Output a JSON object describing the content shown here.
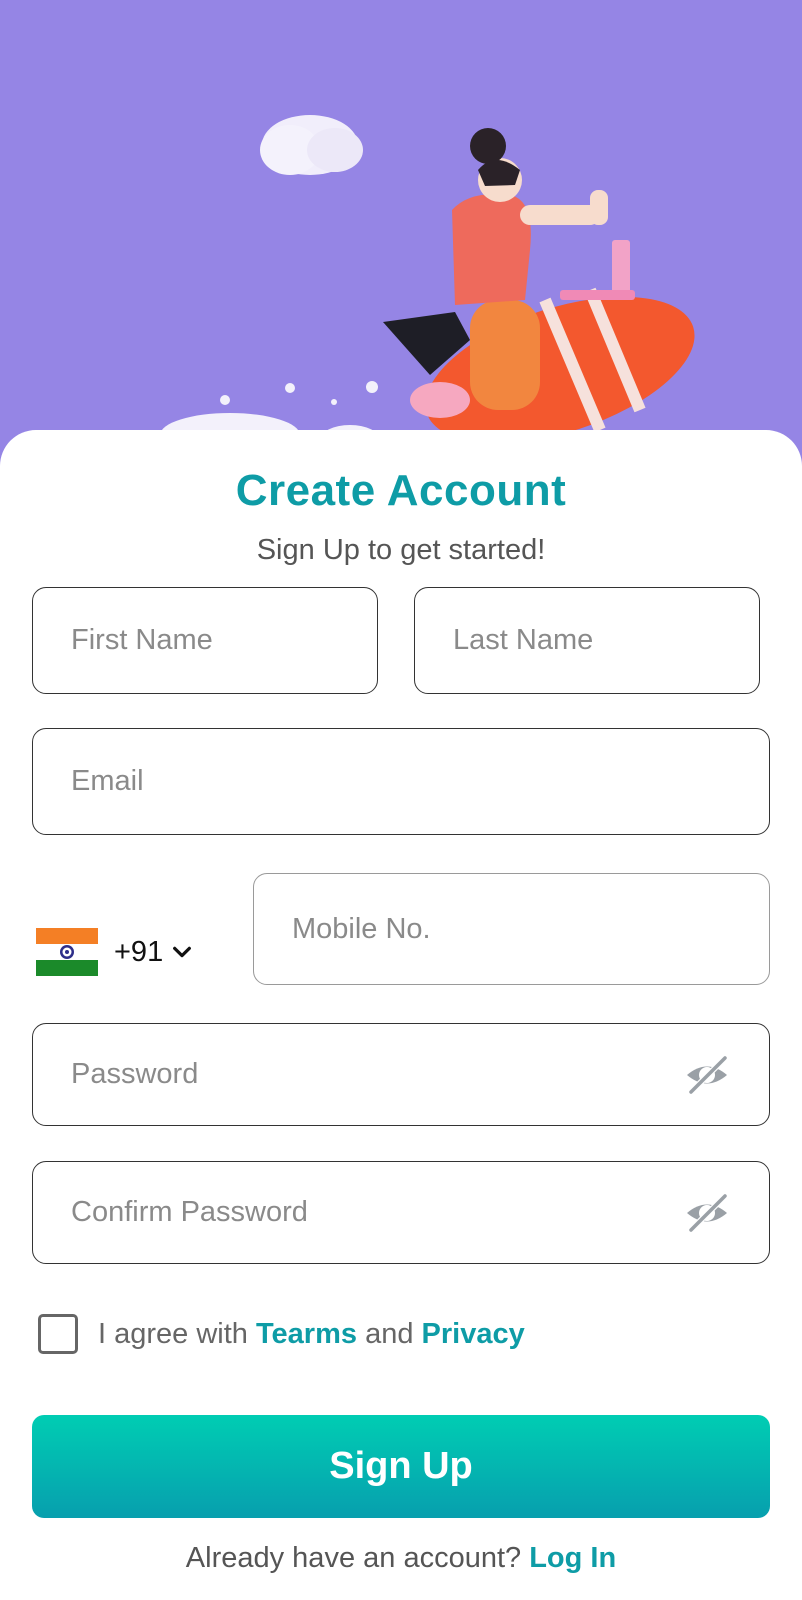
{
  "header": {
    "title": "Create Account",
    "subtitle": "Sign Up to get started!"
  },
  "form": {
    "first_name_placeholder": "First Name",
    "last_name_placeholder": "Last Name",
    "email_placeholder": "Email",
    "country_code": "+91",
    "country_flag": "india-flag-icon",
    "mobile_placeholder": "Mobile No.",
    "password_placeholder": "Password",
    "confirm_password_placeholder": "Confirm Password",
    "password_visibility_icon": "eye-off-icon"
  },
  "agreement": {
    "prefix": "I agree with",
    "terms_label": "Tearms",
    "conjunction": "and",
    "privacy_label": "Privacy",
    "checked": false
  },
  "actions": {
    "signup_label": "Sign Up",
    "login_prompt": "Already have an account?",
    "login_label": "Log In"
  },
  "colors": {
    "accent": "#0e9ca6",
    "hero_bg": "#9585e5",
    "button_gradient_top": "#00cdb3",
    "button_gradient_bottom": "#079fae"
  }
}
